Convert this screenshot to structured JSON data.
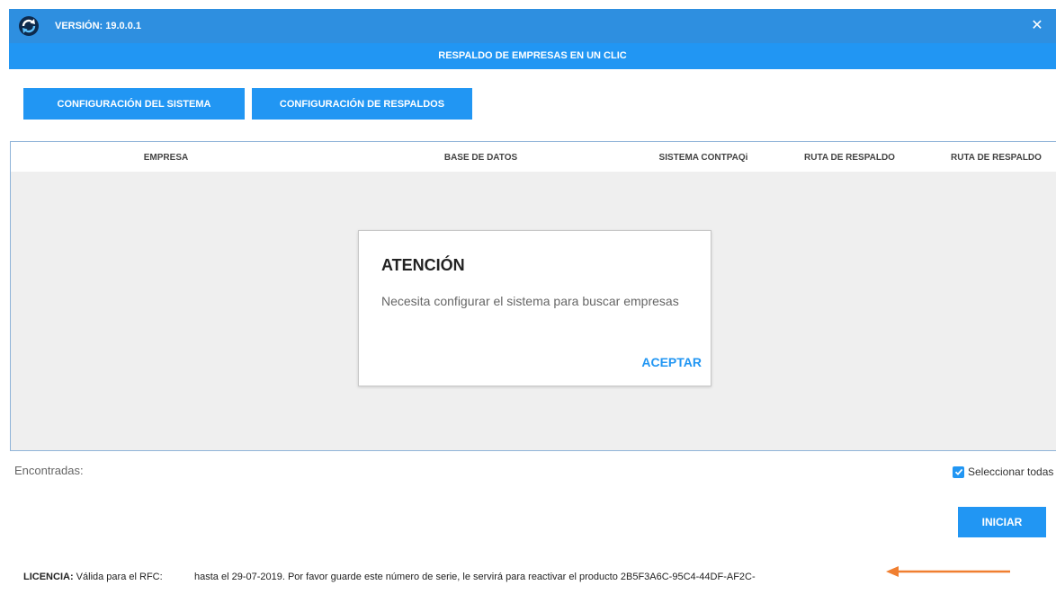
{
  "titlebar": {
    "version": "VERSIÓN: 19.0.0.1",
    "close": "✕"
  },
  "subtitle": "RESPALDO DE EMPRESAS EN UN CLIC",
  "toolbar": {
    "system_config": "CONFIGURACIÓN DEL SISTEMA",
    "backup_config": "CONFIGURACIÓN DE RESPALDOS"
  },
  "table": {
    "columns": [
      "EMPRESA",
      "BASE DE DATOS",
      "SISTEMA CONTPAQi",
      "RUTA DE RESPALDO",
      "RUTA DE RESPALDO"
    ]
  },
  "dialog": {
    "title": "ATENCIÓN",
    "message": "Necesita configurar el sistema para buscar empresas",
    "ok": "ACEPTAR"
  },
  "footer": {
    "found_label": "Encontradas:",
    "select_all": "Seleccionar todas",
    "select_all_checked": true,
    "start": "INICIAR"
  },
  "license": {
    "label": "LICENCIA:",
    "rfc_text": "Válida para el RFC:",
    "details": "hasta el 29-07-2019. Por favor guarde este número de serie, le servirá para reactivar el producto 2B5F3A6C-95C4-44DF-AF2C-"
  },
  "colors": {
    "titlebar": "#2e8fe0",
    "accent": "#2196f3",
    "arrow": "#f07f30",
    "grid_body": "#efefef"
  },
  "icons": {
    "logo": "refresh-sync-logo-icon",
    "close": "close-icon",
    "checkbox": "checkmark-icon",
    "annotation": "arrow-left-icon"
  }
}
